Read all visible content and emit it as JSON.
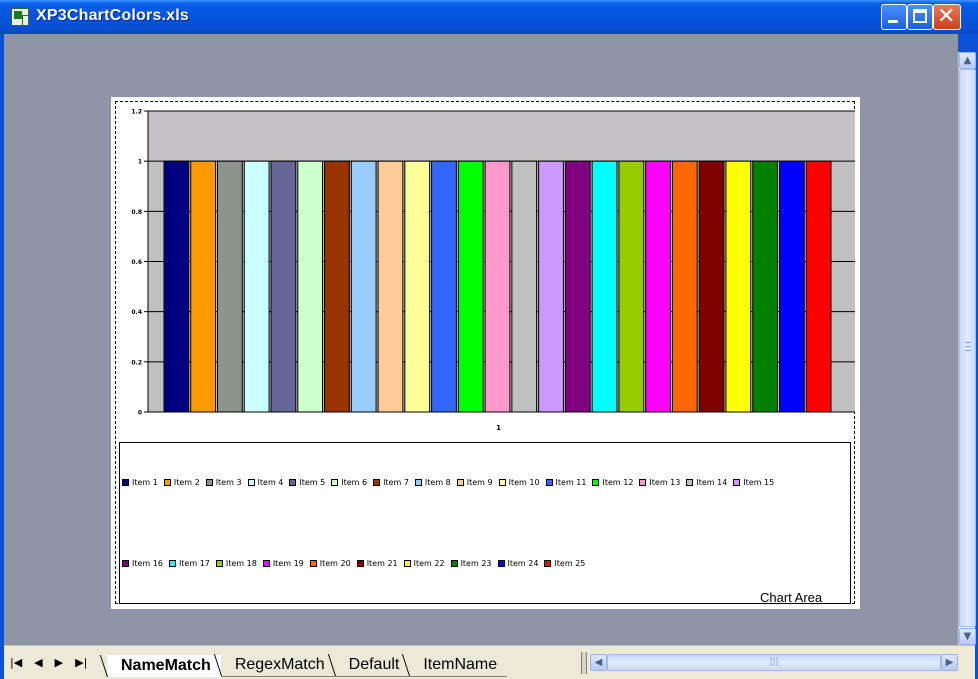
{
  "window": {
    "title": "XP3ChartColors.xls",
    "title_icon": "excel-workbook-icon",
    "controls": {
      "minimize_icon": "minimize-icon",
      "maximize_icon": "maximize-icon",
      "close_icon": "close-icon",
      "close_glyph": "✕"
    }
  },
  "chart_data": {
    "type": "bar",
    "categories": [
      "1"
    ],
    "series": [
      {
        "name": "Item 1",
        "color": "#000080",
        "values": [
          1
        ]
      },
      {
        "name": "Item 2",
        "color": "#ff9900",
        "values": [
          1
        ]
      },
      {
        "name": "Item 3",
        "color": "#8c948c",
        "values": [
          1
        ]
      },
      {
        "name": "Item 4",
        "color": "#ccffff",
        "values": [
          1
        ]
      },
      {
        "name": "Item 5",
        "color": "#666699",
        "values": [
          1
        ]
      },
      {
        "name": "Item 6",
        "color": "#ccffcc",
        "values": [
          1
        ]
      },
      {
        "name": "Item 7",
        "color": "#993300",
        "values": [
          1
        ]
      },
      {
        "name": "Item 8",
        "color": "#99ccff",
        "values": [
          1
        ]
      },
      {
        "name": "Item 9",
        "color": "#ffcc99",
        "values": [
          1
        ]
      },
      {
        "name": "Item 10",
        "color": "#ffff99",
        "values": [
          1
        ]
      },
      {
        "name": "Item 11",
        "color": "#3366ff",
        "values": [
          1
        ]
      },
      {
        "name": "Item 12",
        "color": "#00ff00",
        "values": [
          1
        ]
      },
      {
        "name": "Item 13",
        "color": "#ff99cc",
        "values": [
          1
        ]
      },
      {
        "name": "Item 14",
        "color": "#c0c0c0",
        "values": [
          1
        ]
      },
      {
        "name": "Item 15",
        "color": "#cc99ff",
        "values": [
          1
        ]
      },
      {
        "name": "Item 16",
        "color": "#800080",
        "values": [
          1
        ]
      },
      {
        "name": "Item 17",
        "color": "#00ffff",
        "values": [
          1
        ]
      },
      {
        "name": "Item 18",
        "color": "#99cc00",
        "values": [
          1
        ]
      },
      {
        "name": "Item 19",
        "color": "#ff00ff",
        "values": [
          1
        ]
      },
      {
        "name": "Item 20",
        "color": "#ff6600",
        "values": [
          1
        ]
      },
      {
        "name": "Item 21",
        "color": "#800000",
        "values": [
          1
        ]
      },
      {
        "name": "Item 22",
        "color": "#ffff00",
        "values": [
          1
        ]
      },
      {
        "name": "Item 23",
        "color": "#008000",
        "values": [
          1
        ]
      },
      {
        "name": "Item 24",
        "color": "#0000ff",
        "values": [
          1
        ]
      },
      {
        "name": "Item 25",
        "color": "#ff0000",
        "values": [
          1
        ]
      }
    ],
    "yticks": [
      "0",
      "0.2",
      "0.4",
      "0.6",
      "0.8",
      "1",
      "1.2"
    ],
    "ylim": [
      0,
      1.2
    ],
    "grid": true,
    "legend_position": "bottom",
    "xlabel": "",
    "ylabel": "",
    "title": ""
  },
  "chart": {
    "area_label": "Chart Area",
    "plot_area_color": "#c0c0c0"
  },
  "sheets": {
    "nav": [
      "|◀",
      "◀",
      "▶",
      "▶|"
    ],
    "tabs": [
      {
        "label": "NameMatch",
        "active": true
      },
      {
        "label": "RegexMatch",
        "active": false
      },
      {
        "label": "Default",
        "active": false
      },
      {
        "label": "ItemName",
        "active": false
      }
    ]
  },
  "scrollbars": {
    "up_icon": "scroll-up-arrow-icon",
    "up_glyph": "▲",
    "down_icon": "scroll-down-arrow-icon",
    "down_glyph": "▼",
    "left_icon": "scroll-left-arrow-icon",
    "left_glyph": "◀",
    "right_icon": "scroll-right-arrow-icon",
    "right_glyph": "▶",
    "grip_glyph": "|||"
  }
}
